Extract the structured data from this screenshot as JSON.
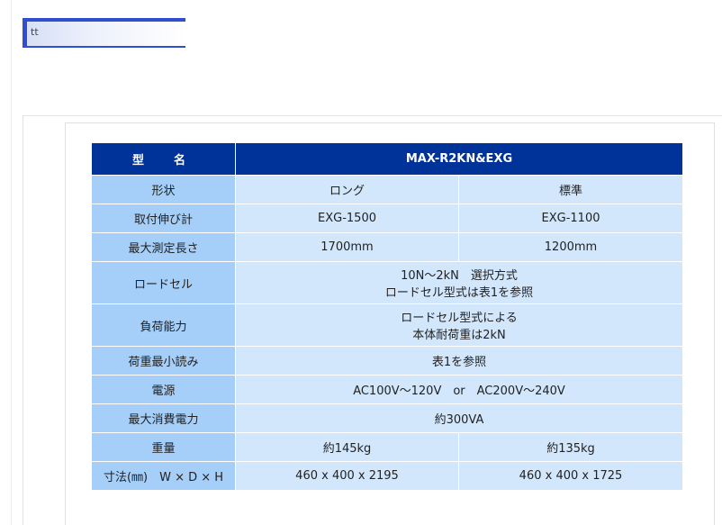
{
  "page": {
    "title_bar_text": "tt"
  },
  "table": {
    "header": {
      "label": "型　名",
      "value": "MAX-R2KN&EXG"
    },
    "rows": [
      {
        "label": "形状",
        "values": [
          "ロング",
          "標準"
        ]
      },
      {
        "label": "取付伸び計",
        "values": [
          "EXG-1500",
          "EXG-1100"
        ]
      },
      {
        "label": "最大測定長さ",
        "values": [
          "1700mm",
          "1200mm"
        ]
      },
      {
        "label": "ロードセル",
        "merged": [
          "10N～2kN　選択方式",
          "ロードセル型式は表1を参照"
        ]
      },
      {
        "label": "負荷能力",
        "merged": [
          "ロードセル型式による",
          "本体耐荷重は2kN"
        ]
      },
      {
        "label": "荷重最小読み",
        "merged": [
          "表1を参照"
        ]
      },
      {
        "label": "電源",
        "merged": [
          "AC100V～120V　or　AC200V～240V"
        ]
      },
      {
        "label": "最大消費電力",
        "merged": [
          "約300VA"
        ]
      },
      {
        "label": "重量",
        "values": [
          "約145kg",
          "約135kg"
        ]
      },
      {
        "label": "寸法(㎜)　W × D × H",
        "values": [
          "460 x 400 x 2195",
          "460 x 400 x 1725"
        ]
      }
    ]
  }
}
